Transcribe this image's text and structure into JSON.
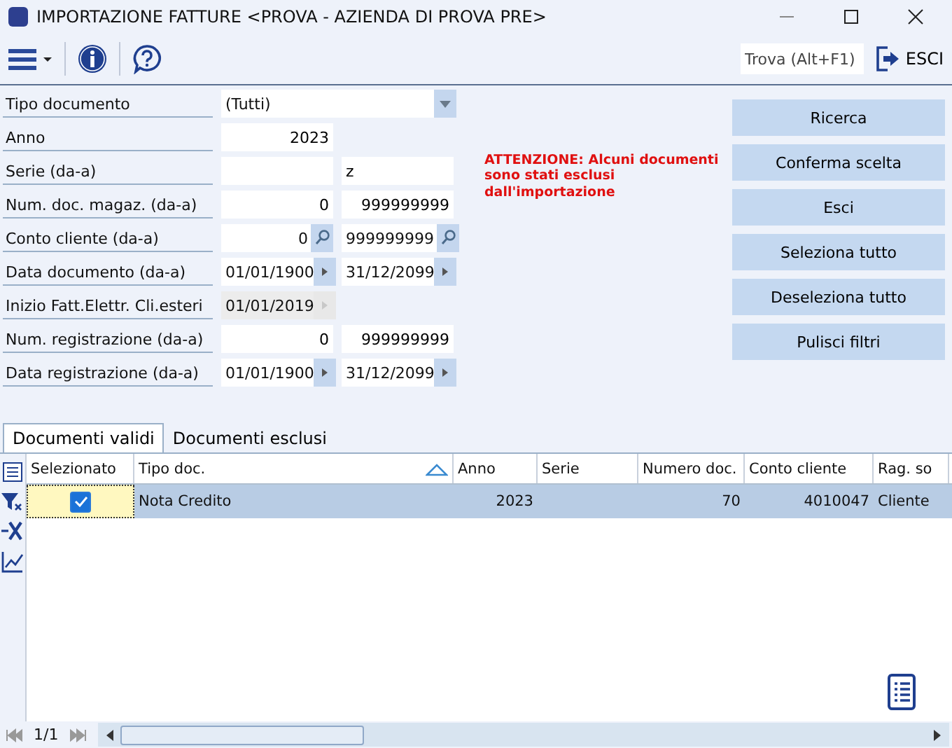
{
  "window": {
    "title": "IMPORTAZIONE FATTURE <PROVA - AZIENDA DI PROVA PRE>"
  },
  "toolbar": {
    "search_placeholder": "Trova (Alt+F1)",
    "exit_label": "ESCI"
  },
  "filters": [
    {
      "label": "Tipo documento",
      "kind": "dropdown",
      "value": "(Tutti)"
    },
    {
      "label": "Anno",
      "kind": "number",
      "value": "2023"
    },
    {
      "label": "Serie (da-a)",
      "kind": "text-range",
      "to": "z"
    },
    {
      "label": "Num. doc. magaz. (da-a)",
      "kind": "number-range",
      "from": "0",
      "to": "999999999"
    },
    {
      "label": "Conto cliente (da-a)",
      "kind": "lookup-range",
      "from": "0",
      "to": "999999999"
    },
    {
      "label": "Data documento (da-a)",
      "kind": "date-range",
      "from": "01/01/1900",
      "to": "31/12/2099"
    },
    {
      "label": "Inizio Fatt.Elettr. Cli.esteri",
      "kind": "date",
      "value": "01/01/2019",
      "disabled": true
    },
    {
      "label": "Num. registrazione (da-a)",
      "kind": "number-range",
      "from": "0",
      "to": "999999999"
    },
    {
      "label": "Data registrazione (da-a)",
      "kind": "date-range",
      "from": "01/01/1900",
      "to": "31/12/2099"
    }
  ],
  "warning": "ATTENZIONE: Alcuni documenti sono stati esclusi dall'importazione",
  "buttons": [
    "Ricerca",
    "Conferma scelta",
    "Esci",
    "Seleziona tutto",
    "Deseleziona tutto",
    "Pulisci filtri"
  ],
  "tabs": [
    {
      "label": "Documenti validi",
      "selected": true
    },
    {
      "label": "Documenti esclusi",
      "selected": false
    }
  ],
  "table": {
    "columns": [
      {
        "label": "Selezionato",
        "sorted": false
      },
      {
        "label": "Tipo doc.",
        "sorted": true
      },
      {
        "label": "Anno",
        "sorted": false
      },
      {
        "label": "Serie",
        "sorted": false
      },
      {
        "label": "Numero doc.",
        "sorted": false
      },
      {
        "label": "Conto cliente",
        "sorted": false
      },
      {
        "label": "Rag. so",
        "sorted": false
      }
    ],
    "rows": [
      {
        "selected": true,
        "checked": true,
        "tipo": "Nota Credito",
        "anno": "2023",
        "numero": "70",
        "conto": "4010047",
        "ragione": "Cliente"
      }
    ]
  },
  "pager": "1/1"
}
